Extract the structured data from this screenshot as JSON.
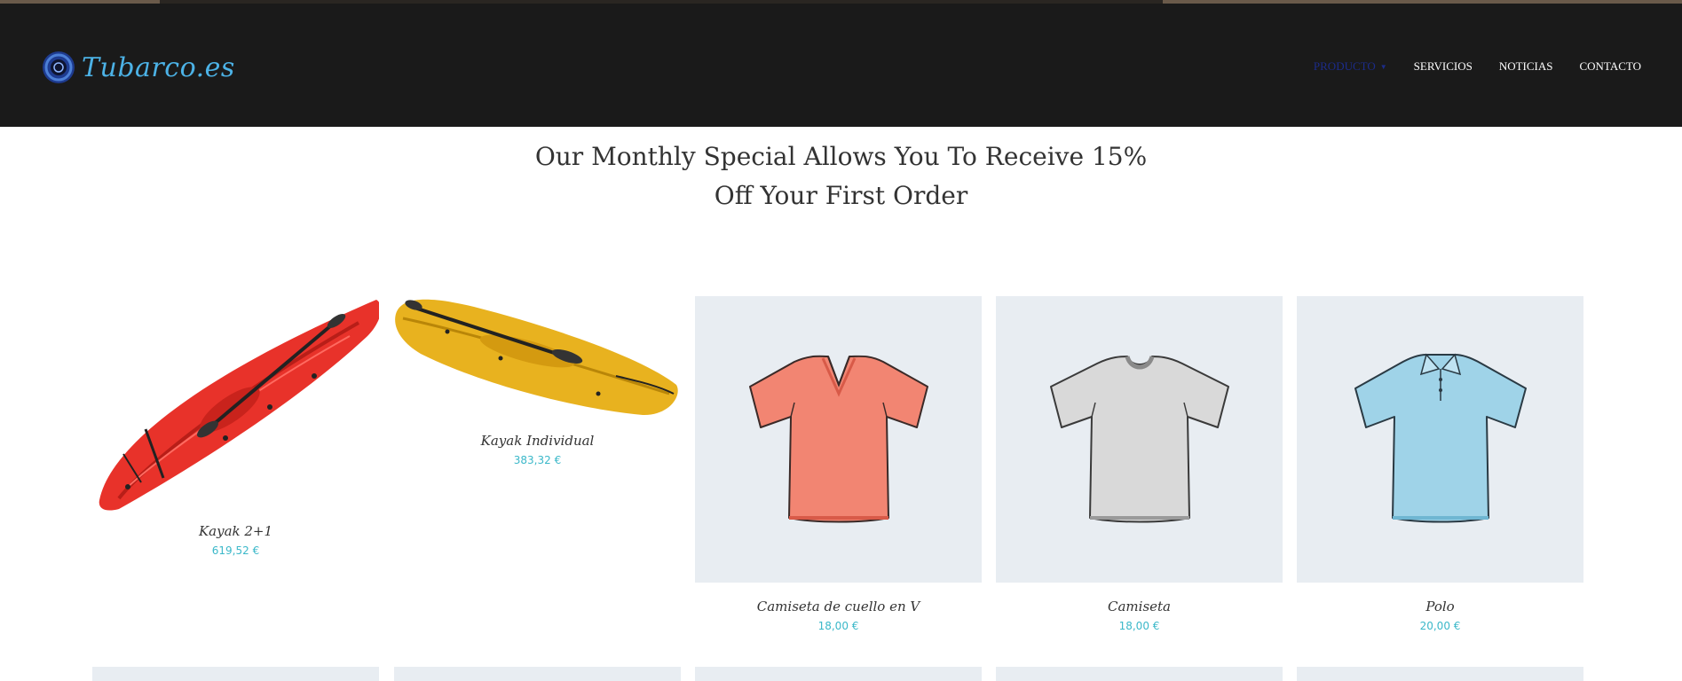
{
  "brand": {
    "logo_text": "Tubarco.es"
  },
  "nav": {
    "items": [
      {
        "label": "PRODUCTO",
        "active": true,
        "has_dropdown": true
      },
      {
        "label": "SERVICIOS",
        "active": false
      },
      {
        "label": "NOTICIAS",
        "active": false
      },
      {
        "label": "CONTACTO",
        "active": false
      }
    ]
  },
  "headline": {
    "line1": "Our Monthly Special Allows You To Receive 15%",
    "line2": "Off Your First Order"
  },
  "products": [
    {
      "name": "Kayak 2+1",
      "price": "619,52 €",
      "image_icon": "red-kayak-image"
    },
    {
      "name": "Kayak Individual",
      "price": "383,32 €",
      "image_icon": "yellow-kayak-image"
    },
    {
      "name": "Camiseta de cuello en V",
      "price": "18,00 €",
      "image_icon": "v-neck-shirt-image"
    },
    {
      "name": "Camiseta",
      "price": "18,00 €",
      "image_icon": "tshirt-image"
    },
    {
      "name": "Polo",
      "price": "20,00 €",
      "image_icon": "polo-shirt-image"
    }
  ],
  "colors": {
    "header_bg": "#1a1a1a",
    "accent_price": "#3bb8c9",
    "nav_active": "#1c2c8a",
    "logo": "#4cb2e6",
    "thumb_bg": "#e8edf2"
  }
}
